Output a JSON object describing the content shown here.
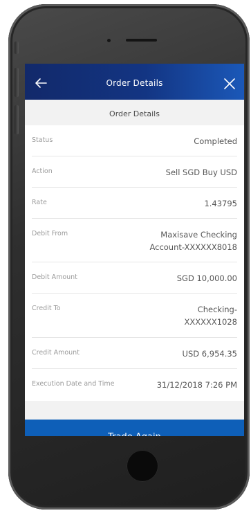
{
  "header": {
    "title": "Order Details"
  },
  "section_title": "Order Details",
  "details": [
    {
      "label": "Status",
      "value": "Completed"
    },
    {
      "label": "Action",
      "value": "Sell SGD Buy USD"
    },
    {
      "label": "Rate",
      "value": "1.43795"
    },
    {
      "label": "Debit From",
      "value": "Maxisave Checking\nAccount-XXXXXX8018"
    },
    {
      "label": "Debit Amount",
      "value": "SGD 10,000.00"
    },
    {
      "label": "Credit To",
      "value": "Checking-\nXXXXXX1028"
    },
    {
      "label": "Credit Amount",
      "value": "USD 6,954.35"
    },
    {
      "label": "Execution Date and Time",
      "value": "31/12/2018 7:26 PM"
    }
  ],
  "footer": {
    "button_label": "Trade Again"
  },
  "colors": {
    "header_start": "#12296a",
    "header_end": "#1b58b8",
    "button": "#0e5fb8"
  },
  "icons": {
    "back": "back-arrow-icon",
    "close": "close-icon"
  }
}
